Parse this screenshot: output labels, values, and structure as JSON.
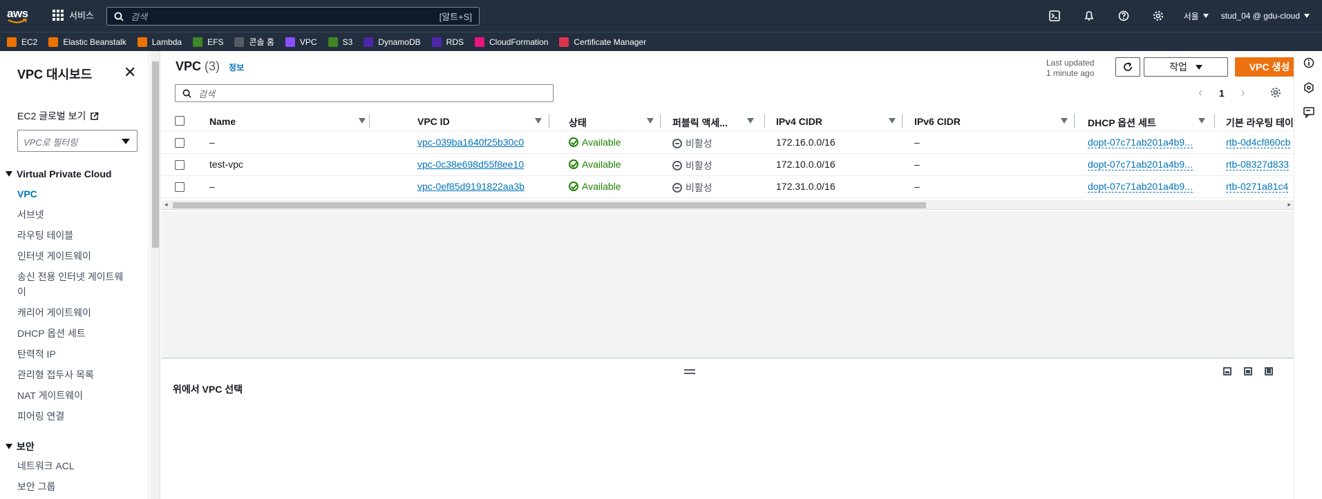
{
  "topbar": {
    "logo_text": "aws",
    "services_label": "서비스",
    "search_placeholder": "검색",
    "search_shortcut": "[알트+S]",
    "region": "서울",
    "account": "stud_04 @ gdu-cloud"
  },
  "favorites": [
    {
      "label": "EC2",
      "color": "#ed7100"
    },
    {
      "label": "Elastic Beanstalk",
      "color": "#ed7100"
    },
    {
      "label": "Lambda",
      "color": "#ed7100"
    },
    {
      "label": "EFS",
      "color": "#3f8624"
    },
    {
      "label": "콘솔 홈",
      "color": "#545b64"
    },
    {
      "label": "VPC",
      "color": "#8c4fff"
    },
    {
      "label": "S3",
      "color": "#3f8624"
    },
    {
      "label": "DynamoDB",
      "color": "#4d27aa"
    },
    {
      "label": "RDS",
      "color": "#4d27aa"
    },
    {
      "label": "CloudFormation",
      "color": "#e7157b"
    },
    {
      "label": "Certificate Manager",
      "color": "#dd344c"
    }
  ],
  "sidebar": {
    "title": "VPC 대시보드",
    "global_view": "EC2 글로벌 보기",
    "filter_placeholder": "VPC로 필터링",
    "section_vpc": "Virtual Private Cloud",
    "vpc_items": [
      "VPC",
      "서브넷",
      "라우팅 테이블",
      "인터넷 게이트웨이",
      "송신 전용 인터넷 게이트웨이",
      "캐리어 게이트웨이",
      "DHCP 옵션 세트",
      "탄력적 IP",
      "관리형 접두사 목록",
      "NAT 게이트웨이",
      "피어링 연결"
    ],
    "section_security": "보안",
    "security_items": [
      "네트워크 ACL",
      "보안 그룹"
    ]
  },
  "main": {
    "title": "VPC",
    "count": "(3)",
    "info": "정보",
    "last_updated_1": "Last updated",
    "last_updated_2": "1 minute ago",
    "actions_label": "작업",
    "create_label": "VPC 생성",
    "search_placeholder": "검색",
    "page": "1",
    "columns": [
      "Name",
      "VPC ID",
      "상태",
      "퍼블릭 액세...",
      "IPv4 CIDR",
      "IPv6 CIDR",
      "DHCP 옵션 세트",
      "기본 라우팅 테이"
    ],
    "rows": [
      {
        "name": "–",
        "vpc_id": "vpc-039ba1640f25b30c0",
        "state": "Available",
        "public": "비활성",
        "ipv4": "172.16.0.0/16",
        "ipv6": "–",
        "dhcp": "dopt-07c71ab201a4b9...",
        "rtb": "rtb-0d4cf860cb"
      },
      {
        "name": "test-vpc",
        "vpc_id": "vpc-0c38e698d55f8ee10",
        "state": "Available",
        "public": "비활성",
        "ipv4": "172.10.0.0/16",
        "ipv6": "–",
        "dhcp": "dopt-07c71ab201a4b9...",
        "rtb": "rtb-08327d833"
      },
      {
        "name": "–",
        "vpc_id": "vpc-0ef85d9191822aa3b",
        "state": "Available",
        "public": "비활성",
        "ipv4": "172.31.0.0/16",
        "ipv6": "–",
        "dhcp": "dopt-07c71ab201a4b9...",
        "rtb": "rtb-0271a81c4"
      }
    ],
    "detail_text": "위에서 VPC 선택"
  }
}
